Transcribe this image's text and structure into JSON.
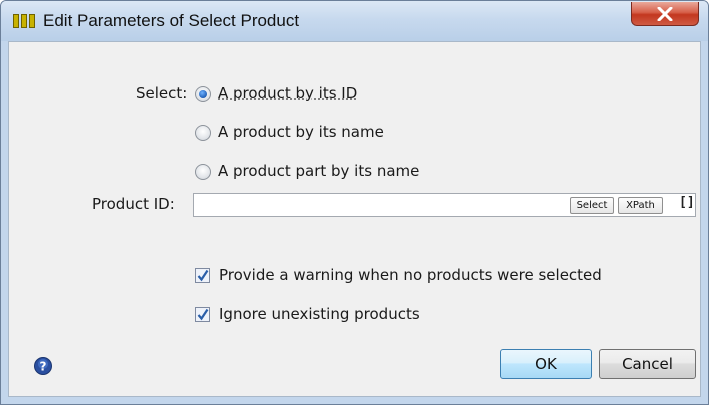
{
  "window": {
    "title": "Edit Parameters of Select Product",
    "close_label": "X"
  },
  "form": {
    "select_label": "Select:",
    "options": [
      {
        "label": "A product by its ID",
        "checked": true
      },
      {
        "label": "A product by its name",
        "checked": false
      },
      {
        "label": "A product part by its name",
        "checked": false
      }
    ],
    "product_id_label": "Product ID:",
    "product_id_value": "",
    "select_button": "Select",
    "xpath_button": "XPath",
    "bracket_button": "[]",
    "warning_checkbox": {
      "label": "Provide a warning when no products were selected",
      "checked": true
    },
    "ignore_checkbox": {
      "label": "Ignore unexisting products",
      "checked": true
    }
  },
  "footer": {
    "ok_label": "OK",
    "cancel_label": "Cancel"
  },
  "icons": {
    "app": "app-icon",
    "close": "close-icon",
    "help": "help-icon"
  },
  "colors": {
    "titlebar": "#c7d9ee",
    "close_button": "#c3371f",
    "ok_border": "#3c7fb1",
    "radio_selected": "#1f5fb8",
    "checkmark": "#2a5ea8"
  }
}
